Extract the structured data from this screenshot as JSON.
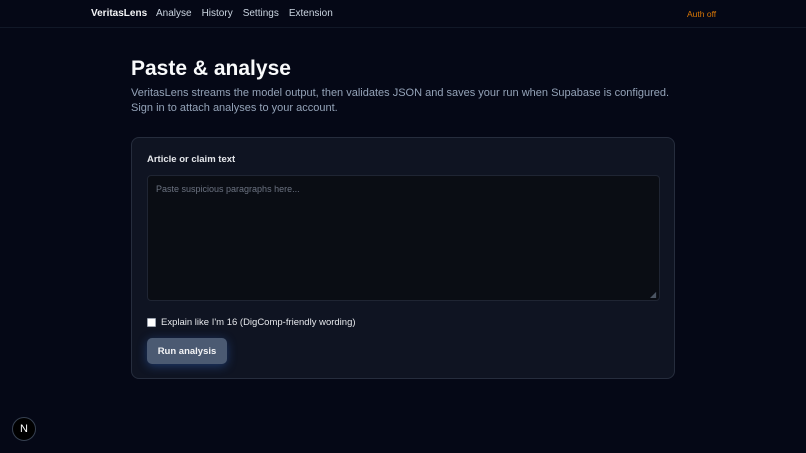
{
  "header": {
    "brand": "VeritasLens",
    "nav": [
      "Analyse",
      "History",
      "Settings",
      "Extension"
    ],
    "auth_status": "Auth off"
  },
  "main": {
    "title": "Paste & analyse",
    "description": "VeritasLens streams the model output, then validates JSON and saves your run when Supabase is configured. Sign in to attach analyses to your account.",
    "form": {
      "field_label": "Article or claim text",
      "textarea_value": "",
      "textarea_placeholder": "Paste suspicious paragraphs here...",
      "checkbox_label": "Explain like I'm 16 (DigComp-friendly wording)",
      "checkbox_checked": false,
      "submit_label": "Run analysis"
    }
  },
  "badge": {
    "letter": "N"
  },
  "colors": {
    "background": "#050816",
    "card": "#0f1422",
    "auth_status": "#d97706",
    "button": "#4b5a72"
  }
}
